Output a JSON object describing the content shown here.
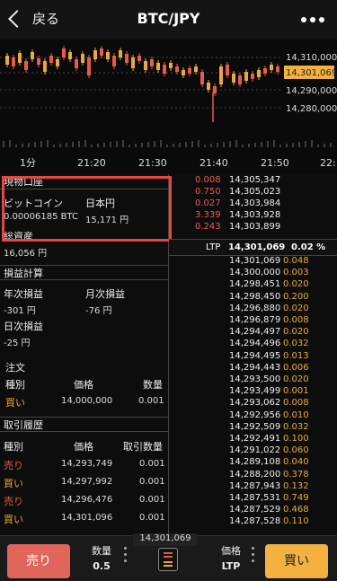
{
  "header": {
    "back_label": "戻る",
    "title": "BTC/JPY"
  },
  "chart": {
    "price_labels": [
      "14,310,000",
      "14,301,069",
      "14,290,000",
      "14,280,000"
    ],
    "time_labels": [
      "1分",
      "21:20",
      "21:30",
      "21:40",
      "21:50",
      "22:"
    ],
    "colors": {
      "up": "#e9a93c",
      "down": "#e75b4f",
      "current_tag": "#f3b23f"
    }
  },
  "assets": {
    "title": "現物口座",
    "btc_label": "ビットコイン",
    "btc_value": "0.00006185 BTC",
    "jpy_label": "日本円",
    "jpy_value": "15,171 円",
    "total_label": "総資産",
    "total_value": "16,056 円"
  },
  "pnl": {
    "title": "損益計算",
    "year_label": "年次損益",
    "year_value": "-301 円",
    "month_label": "月次損益",
    "month_value": "-76 円",
    "day_label": "日次損益",
    "day_value": "-25 円"
  },
  "order": {
    "title": "注文",
    "headers": [
      "種別",
      "価格",
      "数量"
    ],
    "row": {
      "type": "買い",
      "price": "14,000,000",
      "qty": "0.001"
    }
  },
  "history": {
    "title": "取引履歴",
    "headers": [
      "種別",
      "価格",
      "取引数量"
    ],
    "rows": [
      {
        "type": "売り",
        "price": "14,293,749",
        "qty": "0.001"
      },
      {
        "type": "買い",
        "price": "14,297,992",
        "qty": "0.001"
      },
      {
        "type": "売り",
        "price": "14,296,476",
        "qty": "0.001"
      },
      {
        "type": "買い",
        "price": "14,301,096",
        "qty": "0.001"
      }
    ]
  },
  "asks": [
    {
      "qty": "0.008",
      "price": "14,305,347"
    },
    {
      "qty": "0.750",
      "price": "14,305,023"
    },
    {
      "qty": "0.027",
      "price": "14,303,984"
    },
    {
      "qty": "3.339",
      "price": "14,303,928"
    },
    {
      "qty": "0.243",
      "price": "14,303,899"
    }
  ],
  "ltp": {
    "label": "LTP",
    "price": "14,301,069",
    "change": "0.02 %"
  },
  "bids": [
    {
      "price": "14,301,069",
      "qty": "0.048"
    },
    {
      "price": "14,300,000",
      "qty": "0.003"
    },
    {
      "price": "14,298,451",
      "qty": "0.020"
    },
    {
      "price": "14,298,450",
      "qty": "0.200"
    },
    {
      "price": "14,296,880",
      "qty": "0.020"
    },
    {
      "price": "14,296,879",
      "qty": "0.008"
    },
    {
      "price": "14,294,497",
      "qty": "0.020"
    },
    {
      "price": "14,294,496",
      "qty": "0.032"
    },
    {
      "price": "14,294,495",
      "qty": "0.013"
    },
    {
      "price": "14,294,443",
      "qty": "0.006"
    },
    {
      "price": "14,293,500",
      "qty": "0.020"
    },
    {
      "price": "14,293,499",
      "qty": "0.001"
    },
    {
      "price": "14,293,062",
      "qty": "0.008"
    },
    {
      "price": "14,292,956",
      "qty": "0.010"
    },
    {
      "price": "14,292,509",
      "qty": "0.032"
    },
    {
      "price": "14,292,491",
      "qty": "0.100"
    },
    {
      "price": "14,291,022",
      "qty": "0.060"
    },
    {
      "price": "14,289,108",
      "qty": "0.040"
    },
    {
      "price": "14,288,200",
      "qty": "0.378"
    },
    {
      "price": "14,287,943",
      "qty": "0.132"
    },
    {
      "price": "14,287,531",
      "qty": "0.749"
    },
    {
      "price": "14,287,529",
      "qty": "0.468"
    },
    {
      "price": "14,287,528",
      "qty": "0.110"
    }
  ],
  "bottom": {
    "sell_label": "売り",
    "buy_label": "買い",
    "qty_label": "数量",
    "qty_value": "0.5",
    "price_label": "価格",
    "price_value": "LTP",
    "ltp_tag": "14,301,069"
  }
}
